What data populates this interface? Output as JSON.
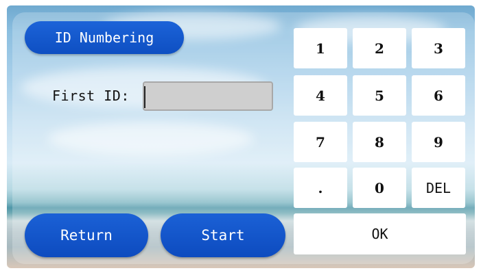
{
  "header": {
    "title": "ID Numbering"
  },
  "form": {
    "first_id_label": "First ID:",
    "first_id_value": ""
  },
  "keypad": {
    "keys": [
      "1",
      "2",
      "3",
      "4",
      "5",
      "6",
      "7",
      "8",
      "9",
      ".",
      "0",
      "DEL"
    ],
    "ok": "OK"
  },
  "actions": {
    "return": "Return",
    "start": "Start"
  },
  "colors": {
    "button_blue": "#0e4fc2",
    "input_gray": "#cfcfcf",
    "key_white": "#ffffff"
  }
}
